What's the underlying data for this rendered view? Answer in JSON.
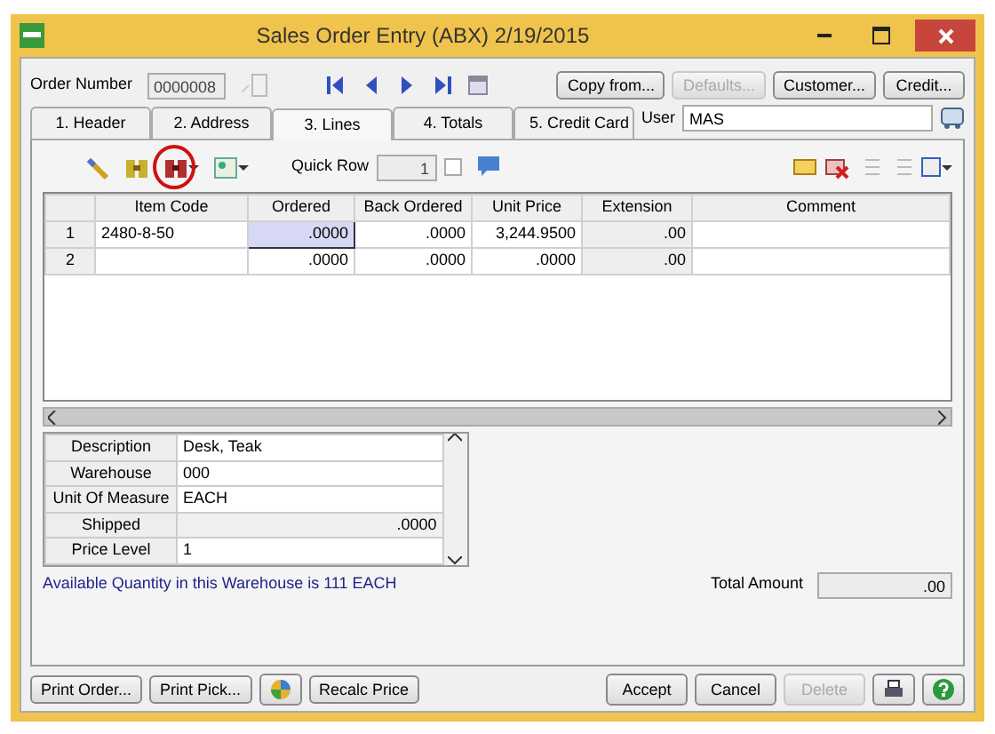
{
  "window": {
    "title": "Sales Order Entry (ABX) 2/19/2015"
  },
  "order": {
    "label": "Order Number",
    "value": "0000008"
  },
  "buttons_top": [
    {
      "label": "Copy from...",
      "disabled": false
    },
    {
      "label": "Defaults...",
      "disabled": true
    },
    {
      "label": "Customer...",
      "disabled": false
    },
    {
      "label": "Credit...",
      "disabled": false
    }
  ],
  "tabs": [
    {
      "label": "1. Header",
      "selected": false
    },
    {
      "label": "2. Address",
      "selected": false
    },
    {
      "label": "3. Lines",
      "selected": true
    },
    {
      "label": "4. Totals",
      "selected": false
    },
    {
      "label": "5. Credit Card",
      "selected": false
    }
  ],
  "user": {
    "label": "User",
    "value": "MAS"
  },
  "toolbar": {
    "tools": [
      {
        "kind": "wand",
        "highlighted": false
      },
      {
        "kind": "binoculars",
        "highlighted": false
      },
      {
        "kind": "binoculars-red",
        "highlighted": true
      },
      {
        "kind": "picture",
        "highlighted": false
      }
    ],
    "quick_row": {
      "label": "Quick Row",
      "value": "1"
    }
  },
  "table": {
    "columns": [
      "Item Code",
      "Ordered",
      "Back Ordered",
      "Unit Price",
      "Extension",
      "Comment"
    ],
    "rows": [
      {
        "number": "1",
        "cells": [
          {
            "text": "2480-8-50",
            "selected": false
          },
          {
            "text": ".0000",
            "selected": true
          },
          {
            "text": ".0000",
            "selected": false
          },
          {
            "text": "3,244.9500",
            "selected": false
          },
          {
            "text": ".00",
            "selected": false
          },
          {
            "text": "",
            "selected": false
          }
        ]
      },
      {
        "number": "2",
        "cells": [
          {
            "text": "",
            "selected": false
          },
          {
            "text": ".0000",
            "selected": false
          },
          {
            "text": ".0000",
            "selected": false
          },
          {
            "text": ".0000",
            "selected": false
          },
          {
            "text": ".00",
            "selected": false
          },
          {
            "text": "",
            "selected": false
          }
        ]
      }
    ]
  },
  "details": [
    {
      "label": "Description",
      "value": "Desk, Teak",
      "kind": "text"
    },
    {
      "label": "Warehouse",
      "value": "000",
      "kind": "text"
    },
    {
      "label": "Unit Of Measure",
      "value": "EACH",
      "kind": "text"
    },
    {
      "label": "Shipped",
      "value": ".0000",
      "kind": "number"
    },
    {
      "label": "Price Level",
      "value": "1",
      "kind": "text"
    }
  ],
  "status": {
    "message": "Available Quantity in this Warehouse is 111 EACH",
    "total_label": "Total Amount",
    "total_value": ".00"
  },
  "buttons_bottom": [
    {
      "label": "Print Order...",
      "disabled": false
    },
    {
      "label": "Print Pick...",
      "disabled": false
    },
    {
      "label": "Recalc Price",
      "disabled": false
    }
  ],
  "buttons_action": [
    {
      "label": "Accept",
      "disabled": false
    },
    {
      "label": "Cancel",
      "disabled": false
    },
    {
      "label": "Delete",
      "disabled": true
    }
  ]
}
